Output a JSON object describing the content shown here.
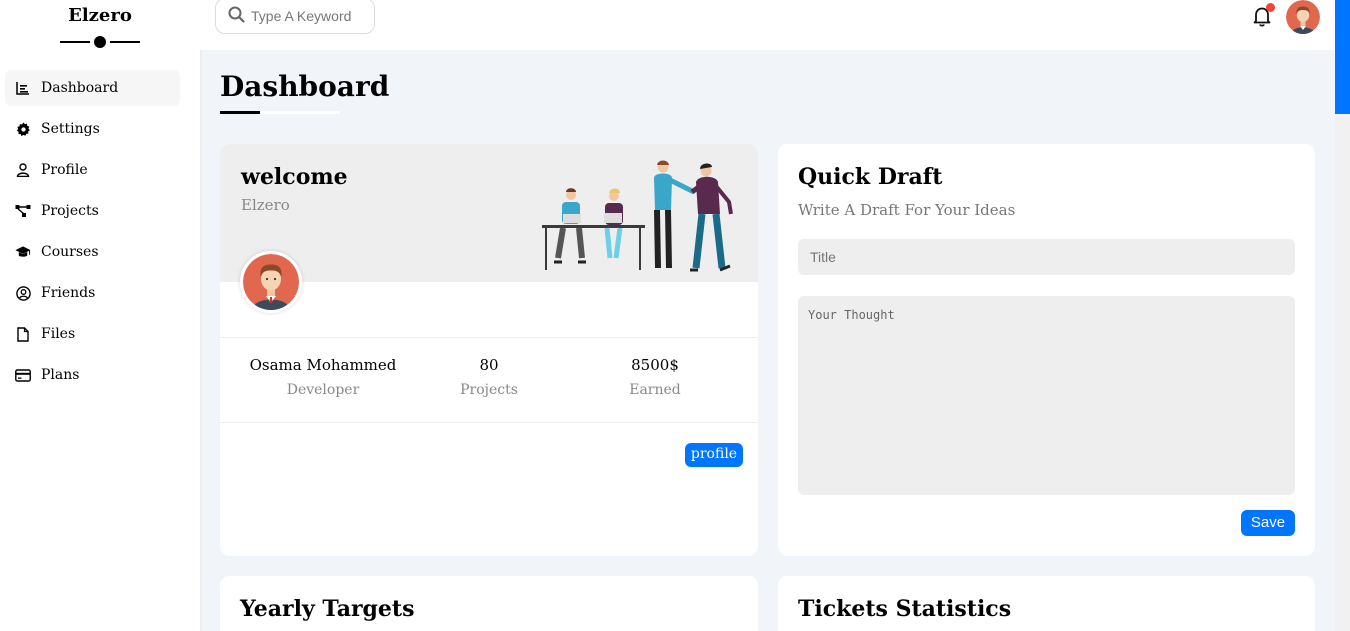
{
  "brand": {
    "name": "Elzero"
  },
  "sidebar": {
    "items": [
      {
        "label": "Dashboard",
        "icon": "chart-icon",
        "active": true
      },
      {
        "label": "Settings",
        "icon": "gear-icon"
      },
      {
        "label": "Profile",
        "icon": "user-icon"
      },
      {
        "label": "Projects",
        "icon": "diagram-icon"
      },
      {
        "label": "Courses",
        "icon": "graduation-cap-icon"
      },
      {
        "label": "Friends",
        "icon": "user-circle-icon"
      },
      {
        "label": "Files",
        "icon": "file-icon"
      },
      {
        "label": "Plans",
        "icon": "credit-card-icon"
      }
    ]
  },
  "header": {
    "search_placeholder": "Type A Keyword",
    "notification_color": "#f44336"
  },
  "page": {
    "title": "Dashboard"
  },
  "welcome": {
    "title": "welcome",
    "subtitle": "Elzero",
    "stats": [
      {
        "value": "Osama Mohammed",
        "label": "Developer"
      },
      {
        "value": "80",
        "label": "Projects"
      },
      {
        "value": "8500$",
        "label": "Earned"
      }
    ],
    "profile_button": "profile"
  },
  "draft": {
    "title": "Quick Draft",
    "subtitle": "Write A Draft For Your Ideas",
    "title_placeholder": "Title",
    "body_placeholder": "Your Thought",
    "save_button": "Save"
  },
  "sections": {
    "yearly_title": "Yearly Targets",
    "tickets_title": "Tickets Statistics"
  },
  "colors": {
    "accent": "#0075ff",
    "background": "#f1f5f9"
  }
}
